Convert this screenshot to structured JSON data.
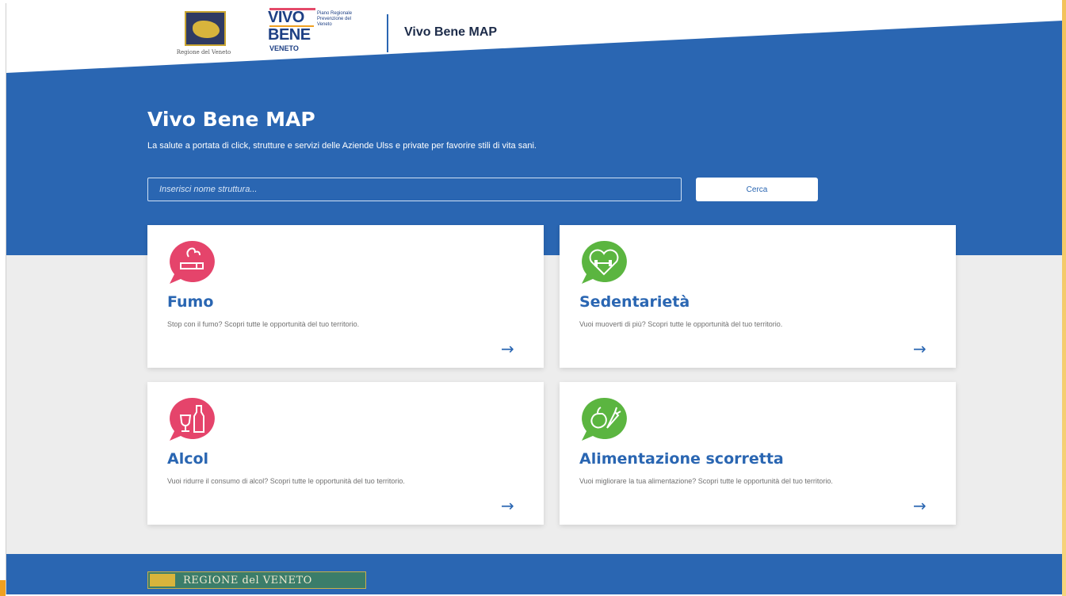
{
  "header": {
    "regione_caption": "Regione del Veneto",
    "logo": {
      "vivo": "VIVO",
      "bene": "BENE",
      "veneto": "VENETO",
      "tagline": "Piano Regionale Prevenzione del Veneto"
    },
    "app_title": "Vivo Bene MAP"
  },
  "hero": {
    "title": "Vivo Bene MAP",
    "subtitle": "La salute a portata di click, strutture e servizi delle Aziende Ulss e private per favorire stili di vita sani."
  },
  "search": {
    "placeholder": "Inserisci nome struttura...",
    "button_label": "Cerca"
  },
  "cards": [
    {
      "title": "Fumo",
      "text": "Stop con il fumo? Scopri tutte le opportunità del tuo territorio.",
      "icon": "cigarette-icon",
      "color": "#e5446b"
    },
    {
      "title": "Sedentarietà",
      "text": "Vuoi muoverti di più? Scopri tutte le opportunità del tuo territorio.",
      "icon": "heart-dumbbell-icon",
      "color": "#5bb540"
    },
    {
      "title": "Alcol",
      "text": "Vuoi ridurre il consumo di alcol? Scopri tutte le opportunità del tuo territorio.",
      "icon": "wine-bottle-icon",
      "color": "#e5446b"
    },
    {
      "title": "Alimentazione scorretta",
      "text": "Vuoi migliorare la tua alimentazione? Scopri tutte le opportunità del tuo territorio.",
      "icon": "apple-carrot-icon",
      "color": "#5bb540"
    }
  ],
  "card_arrow": "→",
  "footer": {
    "logo_text": "REGIONE del VENETO"
  },
  "colors": {
    "primary_blue": "#2a66b2",
    "pink": "#e5446b",
    "green": "#5bb540",
    "background": "#ededed"
  }
}
